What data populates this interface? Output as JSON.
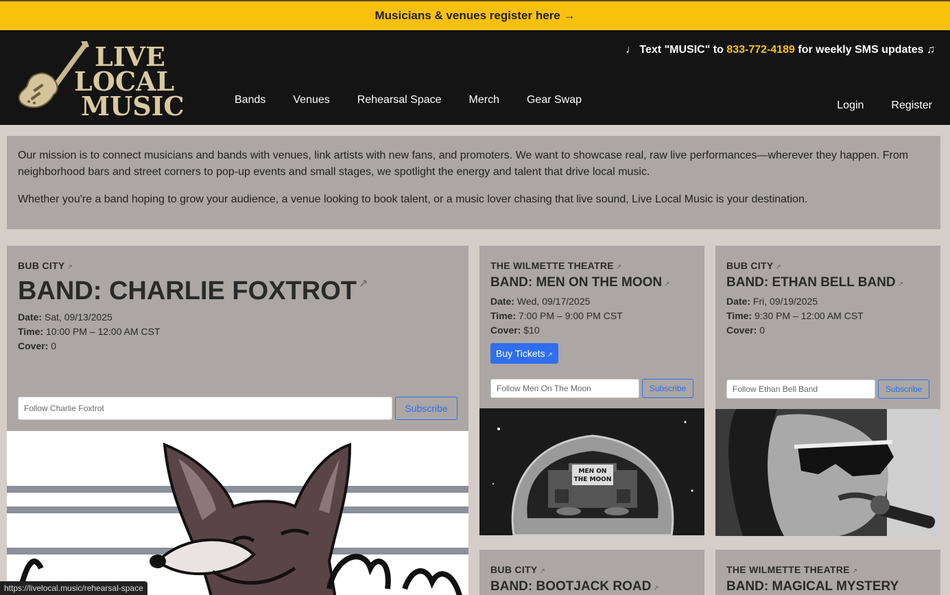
{
  "banner": {
    "text": "Musicians & venues register here →"
  },
  "logo": {
    "line1": "LIVE",
    "line2": "LOCAL",
    "line3": "MUSIC"
  },
  "nav": {
    "items": [
      "Bands",
      "Venues",
      "Rehearsal Space",
      "Merch",
      "Gear Swap"
    ]
  },
  "sms": {
    "prefix": "♩ Text \"MUSIC\" to ",
    "phone": "833-772-4189",
    "suffix": " for weekly SMS updates ♫"
  },
  "auth": {
    "login": "Login",
    "register": "Register"
  },
  "mission": {
    "p1": "Our mission is to connect musicians and bands with venues, link artists with new fans, and promoters. We want to showcase real, raw live performances—wherever they happen. From neighborhood bars and street corners to pop-up events and small stages, we spotlight the energy and talent that drive local music.",
    "p2": "Whether you're a band hoping to grow your audience, a venue looking to book talent, or a music lover chasing that live sound, Live Local Music is your destination."
  },
  "labels": {
    "date": "Date:",
    "time": "Time:",
    "cover": "Cover:",
    "subscribe": "Subscribe",
    "ext": "↗"
  },
  "events": [
    {
      "venue": "BUB CITY",
      "band": "BAND: CHARLIE FOXTROT",
      "date": "Sat, 09/13/2025",
      "time": "10:00 PM – 12:00 AM CST",
      "cover": "0",
      "follow_placeholder": "Follow Charlie Foxtrot",
      "photo": "fox-mascot"
    },
    {
      "venue": "THE WILMETTE THEATRE",
      "band": "BAND: MEN ON THE MOON",
      "date": "Wed, 09/17/2025",
      "time": "7:00 PM – 9:00 PM CST",
      "cover": "$10",
      "tickets": "Buy Tickets",
      "follow_placeholder": "Follow Men On The Moon",
      "photo": "astronaut-helmet",
      "marquee": [
        "MEN ON",
        "THE MOON"
      ]
    },
    {
      "venue": "BUB CITY",
      "band": "BAND: ETHAN BELL BAND",
      "date": "Fri, 09/19/2025",
      "time": "9:30 PM – 12:00 AM CST",
      "cover": "0",
      "follow_placeholder": "Follow Ethan Bell Band",
      "photo": "singer-sunglasses"
    },
    {
      "venue": "BUB CITY",
      "band": "BAND: BOOTJACK ROAD"
    },
    {
      "venue": "THE WILMETTE THEATRE",
      "band": "BAND: MAGICAL MYSTERY"
    }
  ],
  "status_bar": {
    "url": "https://livelocal.music/rehearsal-space"
  }
}
